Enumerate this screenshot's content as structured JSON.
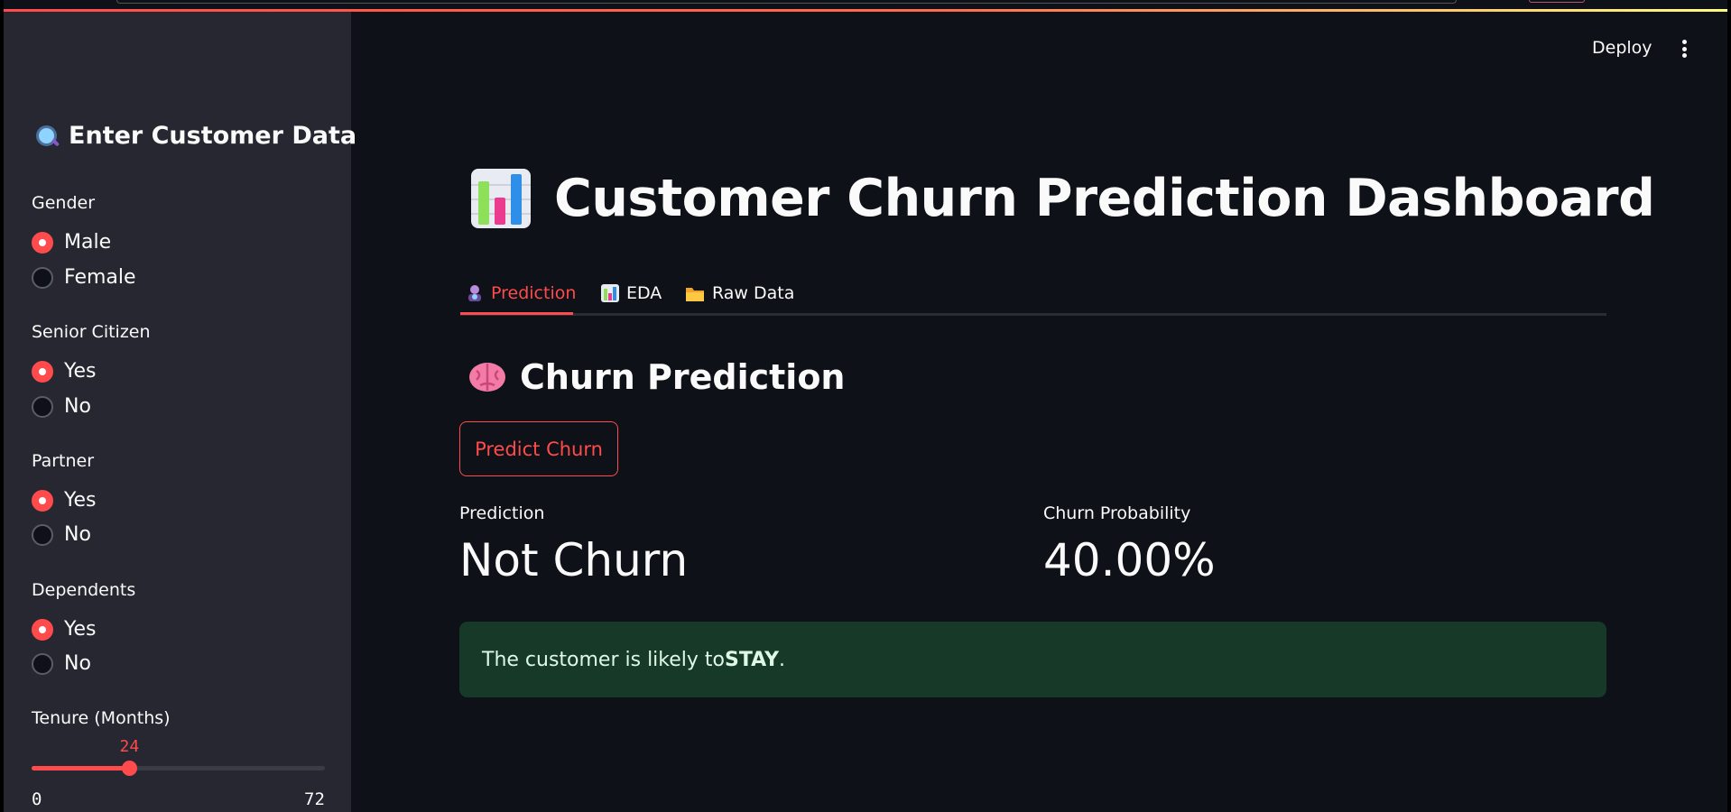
{
  "header": {
    "deploy_label": "Deploy"
  },
  "sidebar": {
    "title": "Enter Customer Data",
    "title_icon": "magnifier-icon",
    "groups": [
      {
        "label": "Gender",
        "options": [
          "Male",
          "Female"
        ],
        "selected": "Male"
      },
      {
        "label": "Senior Citizen",
        "options": [
          "Yes",
          "No"
        ],
        "selected": "Yes"
      },
      {
        "label": "Partner",
        "options": [
          "Yes",
          "No"
        ],
        "selected": "Yes"
      },
      {
        "label": "Dependents",
        "options": [
          "Yes",
          "No"
        ],
        "selected": "Yes"
      }
    ],
    "tenure": {
      "label": "Tenure (Months)",
      "value": 24,
      "min": 0,
      "max": 72
    }
  },
  "main": {
    "title": "Customer Churn Prediction Dashboard",
    "title_icon": "bar-chart-icon",
    "tabs": [
      {
        "label": "Prediction",
        "icon": "fortune-teller-icon",
        "active": true
      },
      {
        "label": "EDA",
        "icon": "bar-chart-icon",
        "active": false
      },
      {
        "label": "Raw Data",
        "icon": "folder-icon",
        "active": false
      }
    ],
    "section_title": "Churn Prediction",
    "section_icon": "brain-icon",
    "button_label": "Predict Churn",
    "metrics": [
      {
        "label": "Prediction",
        "value": "Not Churn"
      },
      {
        "label": "Churn Probability",
        "value": "40.00%"
      }
    ],
    "alert": {
      "prefix": "The customer is likely to ",
      "emphasis": "STAY",
      "suffix": "."
    }
  },
  "colors": {
    "accent": "#ff4b4b",
    "background": "#0e1117",
    "sidebar": "#262730",
    "success_bg": "#173928"
  }
}
